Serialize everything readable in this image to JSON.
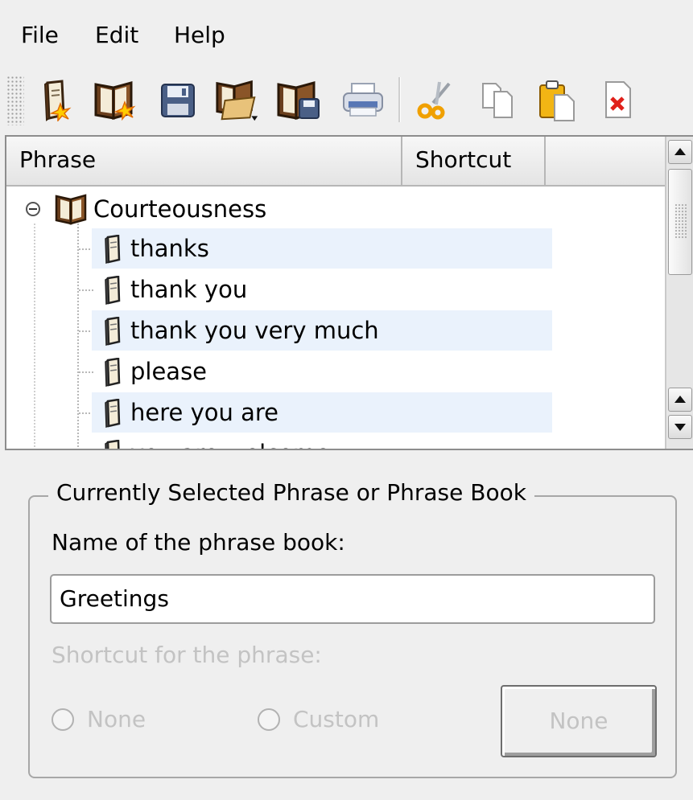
{
  "menubar": {
    "file": "File",
    "edit": "Edit",
    "help": "Help"
  },
  "toolbar": {
    "buttons": [
      {
        "icon": "new-phrase-icon"
      },
      {
        "icon": "new-phrase-book-icon"
      },
      {
        "icon": "save-icon"
      },
      {
        "icon": "import-phrase-book-icon"
      },
      {
        "icon": "export-phrase-book-icon"
      },
      {
        "icon": "print-icon"
      },
      {
        "icon": "cut-icon"
      },
      {
        "icon": "copy-icon"
      },
      {
        "icon": "paste-icon"
      },
      {
        "icon": "delete-icon"
      }
    ]
  },
  "tree": {
    "columns": [
      "Phrase",
      "Shortcut"
    ],
    "root": {
      "label": "Courteousness",
      "expanded": true
    },
    "children": [
      {
        "label": "thanks"
      },
      {
        "label": "thank you"
      },
      {
        "label": "thank you very much"
      },
      {
        "label": "please"
      },
      {
        "label": "here you are"
      },
      {
        "label": "you are welcome"
      }
    ]
  },
  "group": {
    "title": "Currently Selected Phrase or Phrase Book",
    "name_label": "Name of the phrase book:",
    "name_value": "Greetings",
    "shortcut_label": "Shortcut for the phrase:",
    "radio_none": "None",
    "radio_custom": "Custom",
    "shortcut_button": "None"
  },
  "colors": {
    "window_bg": "#efefef",
    "alt_row": "#eaf2fc",
    "disabled_text": "#c3c3c3"
  }
}
